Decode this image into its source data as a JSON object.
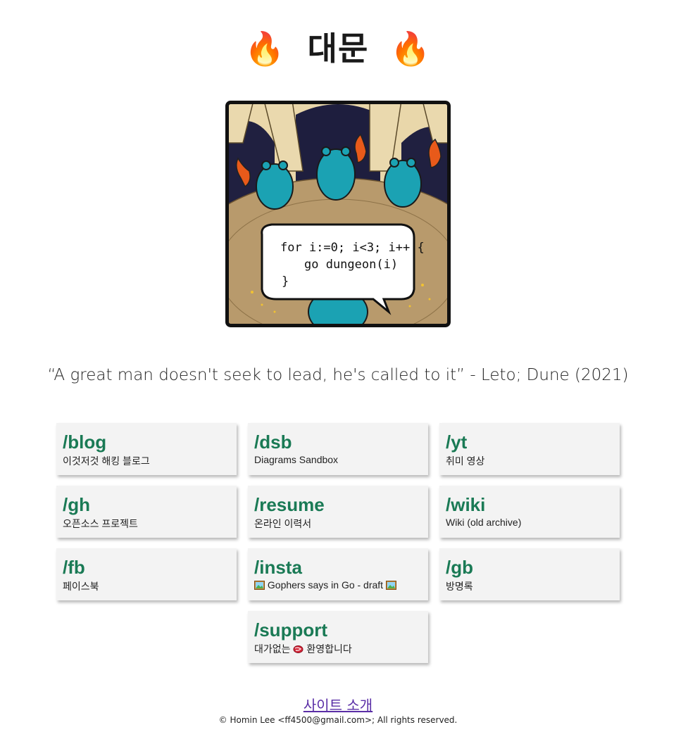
{
  "header": {
    "title": "대문",
    "left_emoji": "🔥",
    "right_emoji": "🔥"
  },
  "hero": {
    "code_line1": "for i:=0; i<3; i++ {",
    "code_line2": "go dungeon(i)",
    "code_line3": "}"
  },
  "quote": "“A great man doesn't seek to lead, he's called to it” - Leto; Dune (2021)",
  "cards": [
    {
      "path": "/blog",
      "desc": "이것저것 해킹 블로그"
    },
    {
      "path": "/dsb",
      "desc": "Diagrams Sandbox"
    },
    {
      "path": "/yt",
      "desc": "취미 영상"
    },
    {
      "path": "/gh",
      "desc": "오픈소스 프로젝트"
    },
    {
      "path": "/resume",
      "desc": "온라인 이력서"
    },
    {
      "path": "/wiki",
      "desc": "Wiki (old archive)"
    },
    {
      "path": "/fb",
      "desc": "페이스북"
    },
    {
      "path": "/insta",
      "desc": "Gophers says in Go - draft"
    },
    {
      "path": "/gb",
      "desc": "방명록"
    },
    {
      "path": "/support",
      "desc_before": "대가없는",
      "desc_after": "환영합니다"
    }
  ],
  "footer": {
    "about_link": "사이트 소개",
    "copyright": "© Homin Lee <ff4500@gmail.com>; All rights reserved."
  },
  "colors": {
    "card_title": "#1a7a55",
    "card_bg": "#f3f3f3",
    "link": "#5a2ea6",
    "gopher": "#1ba2b3"
  }
}
